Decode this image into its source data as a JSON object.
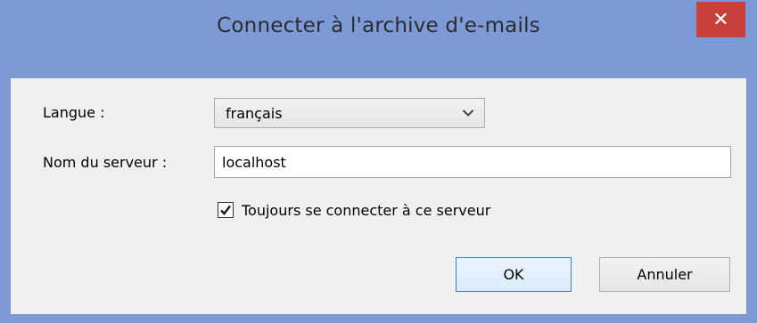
{
  "window": {
    "title": "Connecter à l'archive d'e-mails",
    "close_label": "✕"
  },
  "form": {
    "language_label": "Langue :",
    "language_value": "français",
    "server_label": "Nom du serveur :",
    "server_value": "localhost",
    "always_connect_label": "Toujours se connecter à ce serveur",
    "always_connect_checked": true
  },
  "buttons": {
    "ok_label": "OK",
    "cancel_label": "Annuler"
  },
  "icons": {
    "close": "close-icon",
    "dropdown": "chevron-down-icon",
    "check": "checkmark-icon"
  },
  "colors": {
    "frame": "#7d9ad6",
    "close_button": "#c7403a",
    "ok_border": "#3c7fb1"
  }
}
